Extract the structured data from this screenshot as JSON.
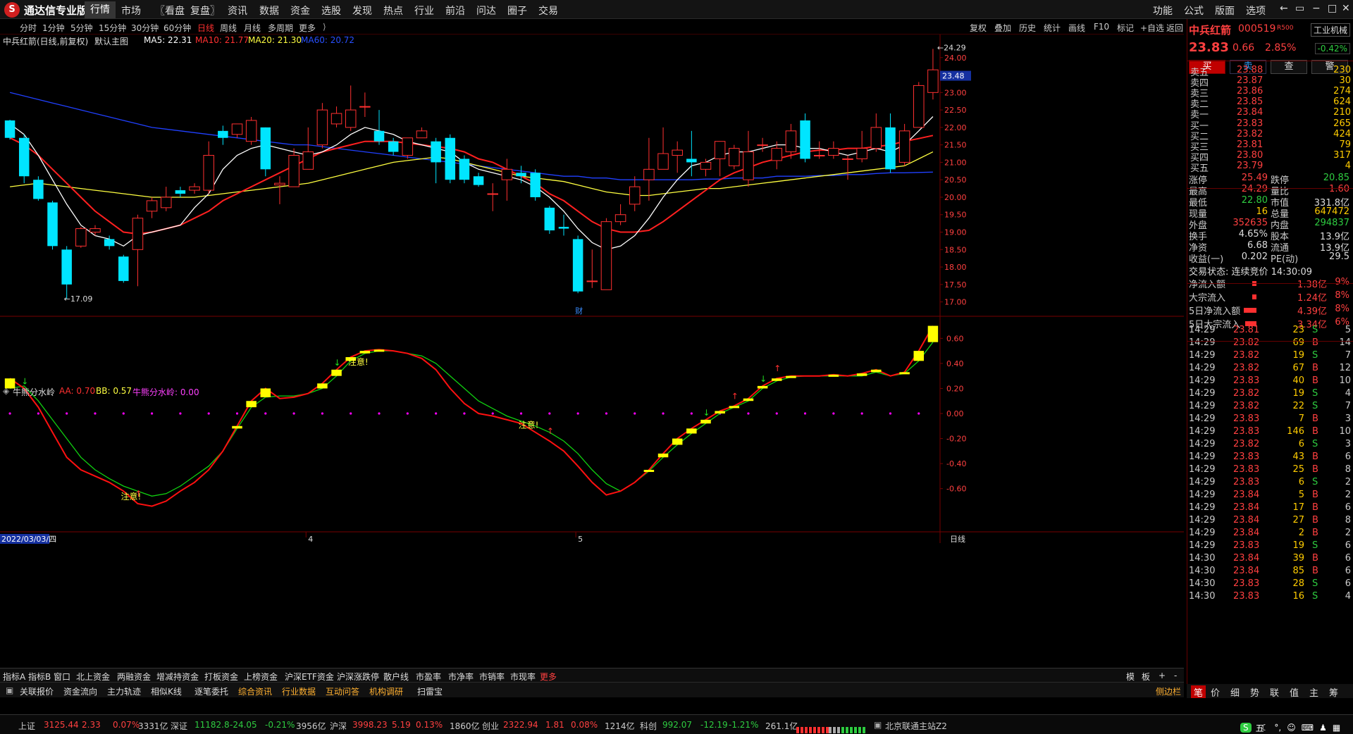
{
  "app": {
    "logo": "S",
    "title": "通达信专业版"
  },
  "menu": [
    "行情",
    "市场",
    "〖看盘",
    "复盘〗",
    "资讯",
    "数据",
    "资金",
    "选股",
    "发现",
    "热点",
    "行业",
    "前沿",
    "问达",
    "圈子",
    "交易"
  ],
  "menu_right": [
    "功能",
    "公式",
    "版面",
    "选项"
  ],
  "window_controls": [
    "←",
    "▭",
    "−",
    "□",
    "✕"
  ],
  "timeframes": [
    "分时",
    "1分钟",
    "5分钟",
    "15分钟",
    "30分钟",
    "60分钟",
    "日线",
    "周线",
    "月线",
    "多周期",
    "更多"
  ],
  "toolbar_right": [
    "复权",
    "叠加",
    "历史",
    "统计",
    "画线",
    "F10",
    "标记",
    "+自选",
    "返回"
  ],
  "colors": {
    "up": "#ff3030",
    "down": "#00e5ff",
    "ma5": "#ffffff",
    "ma10": "#ff2020",
    "ma20": "#ffff40",
    "ma60": "#2040ff",
    "fast": "#ff1010",
    "slow": "#10d010",
    "bar": "#ffff00",
    "zero": "#ff00ff"
  },
  "main_info": {
    "stock": "中兵红箭(日线,前复权)",
    "panel": "默认主图",
    "ma5": "MA5: 22.31",
    "ma10": "MA10: 21.77",
    "ma20": "MA20: 21.30",
    "ma60": "MA60: 20.72"
  },
  "sub_info": {
    "name": "牛熊分水岭",
    "aa": "AA: 0.70",
    "bb": "BB: 0.57",
    "line": "牛熊分水岭: 0.00"
  },
  "chart_data": {
    "type": "candlestick",
    "price_axis": {
      "ticks": [
        24.0,
        23.5,
        23.0,
        22.5,
        22.0,
        21.5,
        21.0,
        20.5,
        20.0,
        19.5,
        19.0,
        18.5,
        18.0,
        17.5,
        17.0
      ],
      "min": 16.75,
      "max": 24.5,
      "current_tag": "23.48"
    },
    "ind_axis": {
      "ticks": [
        0.6,
        0.4,
        0.2,
        0.0,
        -0.2,
        -0.4,
        -0.6
      ],
      "min": -0.9,
      "max": 0.72
    },
    "candles": [
      [
        22.2,
        21.7,
        22.22,
        21.65
      ],
      [
        21.7,
        20.6,
        21.8,
        20.4
      ],
      [
        20.5,
        19.95,
        20.6,
        19.9
      ],
      [
        19.85,
        18.6,
        19.9,
        18.5
      ],
      [
        18.5,
        17.5,
        18.6,
        17.09
      ],
      [
        18.6,
        19.1,
        19.15,
        18.55
      ],
      [
        19.0,
        19.1,
        19.2,
        18.9
      ],
      [
        18.8,
        18.6,
        18.9,
        18.5
      ],
      [
        18.3,
        17.6,
        18.35,
        17.55
      ],
      [
        18.5,
        19.4,
        19.5,
        17.45
      ],
      [
        19.6,
        19.9,
        20.0,
        19.4
      ],
      [
        19.7,
        20.0,
        20.3,
        19.6
      ],
      [
        20.2,
        20.1,
        20.3,
        20.0
      ],
      [
        20.2,
        20.3,
        20.4,
        20.1
      ],
      [
        20.2,
        21.2,
        21.6,
        20.1
      ],
      [
        21.9,
        21.7,
        22.05,
        21.5
      ],
      [
        21.8,
        22.1,
        22.1,
        21.7
      ],
      [
        21.6,
        22.2,
        22.3,
        21.5
      ],
      [
        22.0,
        20.8,
        22.0,
        20.6
      ],
      [
        20.35,
        20.4,
        20.6,
        19.8
      ],
      [
        20.3,
        21.2,
        21.4,
        20.3
      ],
      [
        20.8,
        21.3,
        22.0,
        20.8
      ],
      [
        21.5,
        22.5,
        22.7,
        21.4
      ],
      [
        22.1,
        22.4,
        22.6,
        22.0
      ],
      [
        22.0,
        22.5,
        23.2,
        21.9
      ],
      [
        22.6,
        22.6,
        23.0,
        22.3
      ],
      [
        21.9,
        21.6,
        22.5,
        21.5
      ],
      [
        21.6,
        21.3,
        21.7,
        21.2
      ],
      [
        21.2,
        21.7,
        21.7,
        21.1
      ],
      [
        21.7,
        21.9,
        22.0,
        21.7
      ],
      [
        21.6,
        21.0,
        21.7,
        20.4
      ],
      [
        21.7,
        20.5,
        21.8,
        20.4
      ],
      [
        21.1,
        20.5,
        21.2,
        20.4
      ],
      [
        20.6,
        20.35,
        20.7,
        20.3
      ],
      [
        20.1,
        20.1,
        20.4,
        19.6
      ],
      [
        20.5,
        20.8,
        21.1,
        19.9
      ],
      [
        20.7,
        20.6,
        20.9,
        20.4
      ],
      [
        20.7,
        20.0,
        20.8,
        19.9
      ],
      [
        19.7,
        19.05,
        19.75,
        18.95
      ],
      [
        19.15,
        19.1,
        19.5,
        18.9
      ],
      [
        18.8,
        17.3,
        18.9,
        17.25
      ],
      [
        17.6,
        17.6,
        18.5,
        17.4
      ],
      [
        17.35,
        19.3,
        19.4,
        17.35
      ],
      [
        19.3,
        19.5,
        19.8,
        19.2
      ],
      [
        19.8,
        20.3,
        20.6,
        19.6
      ],
      [
        20.5,
        20.8,
        21.7,
        19.9
      ],
      [
        20.8,
        21.25,
        22.0,
        20.8
      ],
      [
        21.2,
        21.35,
        21.6,
        20.7
      ],
      [
        21.1,
        21.0,
        21.9,
        20.6
      ],
      [
        20.8,
        21.0,
        21.1,
        20.6
      ],
      [
        21.1,
        21.6,
        21.6,
        20.6
      ],
      [
        20.9,
        21.4,
        21.5,
        20.8
      ],
      [
        20.5,
        21.3,
        21.9,
        20.3
      ],
      [
        21.5,
        21.5,
        21.7,
        21.3
      ],
      [
        21.05,
        21.4,
        21.6,
        20.8
      ],
      [
        21.3,
        21.9,
        22.1,
        21.1
      ],
      [
        22.2,
        21.1,
        22.4,
        21.0
      ],
      [
        21.2,
        21.2,
        21.6,
        21.1
      ],
      [
        21.2,
        21.4,
        21.6,
        21.1
      ],
      [
        21.1,
        21.1,
        21.2,
        20.5
      ],
      [
        21.1,
        21.4,
        21.9,
        21.0
      ],
      [
        21.4,
        22.0,
        22.4,
        21.3
      ],
      [
        22.0,
        20.8,
        22.4,
        20.7
      ],
      [
        21.0,
        21.9,
        22.1,
        20.9
      ],
      [
        22.0,
        23.2,
        23.3,
        22.0
      ],
      [
        23.0,
        23.65,
        24.25,
        22.8
      ]
    ],
    "ma5": [
      22.1,
      21.8,
      21.2,
      20.5,
      19.8,
      19.2,
      18.9,
      18.8,
      18.6,
      18.9,
      19.0,
      19.1,
      19.2,
      19.7,
      20.1,
      20.8,
      21.2,
      21.4,
      21.5,
      21.4,
      21.3,
      21.2,
      21.3,
      21.5,
      21.8,
      22.0,
      21.9,
      21.8,
      21.6,
      21.5,
      21.4,
      21.3,
      21.0,
      20.8,
      20.7,
      20.6,
      20.5,
      20.3,
      20.0,
      19.6,
      19.1,
      18.7,
      18.5,
      18.6,
      18.9,
      19.4,
      20.0,
      20.5,
      20.9,
      21.0,
      21.2,
      21.3,
      21.3,
      21.4,
      21.5,
      21.5,
      21.4,
      21.4,
      21.3,
      21.2,
      21.3,
      21.4,
      21.3,
      21.5,
      21.9,
      22.31
    ],
    "ma10": [
      21.7,
      21.5,
      21.2,
      20.8,
      20.4,
      20.0,
      19.6,
      19.3,
      19.0,
      18.95,
      19.0,
      19.1,
      19.2,
      19.4,
      19.6,
      19.9,
      20.1,
      20.3,
      20.5,
      20.7,
      20.9,
      21.1,
      21.3,
      21.4,
      21.5,
      21.6,
      21.6,
      21.6,
      21.55,
      21.5,
      21.45,
      21.4,
      21.3,
      21.1,
      21.0,
      20.8,
      20.6,
      20.4,
      20.1,
      19.9,
      19.6,
      19.3,
      19.1,
      19.0,
      19.0,
      19.05,
      19.3,
      19.6,
      19.9,
      20.2,
      20.5,
      20.7,
      20.85,
      21.0,
      21.1,
      21.2,
      21.3,
      21.35,
      21.35,
      21.4,
      21.4,
      21.45,
      21.5,
      21.6,
      21.68,
      21.77
    ],
    "ma20": [
      20.3,
      20.35,
      20.4,
      20.35,
      20.3,
      20.25,
      20.2,
      20.15,
      20.1,
      20.05,
      20.0,
      20.0,
      20.0,
      20.0,
      20.05,
      20.1,
      20.15,
      20.2,
      20.25,
      20.3,
      20.35,
      20.4,
      20.5,
      20.6,
      20.7,
      20.8,
      20.9,
      21.0,
      21.05,
      21.1,
      21.15,
      21.1,
      21.0,
      20.9,
      20.8,
      20.7,
      20.6,
      20.55,
      20.5,
      20.45,
      20.35,
      20.25,
      20.15,
      20.1,
      20.05,
      20.05,
      20.1,
      20.15,
      20.2,
      20.25,
      20.25,
      20.3,
      20.35,
      20.4,
      20.45,
      20.5,
      20.55,
      20.6,
      20.65,
      20.7,
      20.75,
      20.8,
      20.85,
      20.9,
      21.1,
      21.3
    ],
    "ma60": [
      23.0,
      22.9,
      22.8,
      22.7,
      22.6,
      22.5,
      22.4,
      22.3,
      22.2,
      22.1,
      22.0,
      21.95,
      21.9,
      21.85,
      21.8,
      21.75,
      21.7,
      21.65,
      21.6,
      21.55,
      21.5,
      21.5,
      21.45,
      21.4,
      21.35,
      21.3,
      21.25,
      21.2,
      21.15,
      21.1,
      21.05,
      21.0,
      20.95,
      20.9,
      20.85,
      20.8,
      20.75,
      20.7,
      20.65,
      20.6,
      20.6,
      20.55,
      20.55,
      20.5,
      20.5,
      20.5,
      20.5,
      20.5,
      20.5,
      20.52,
      20.52,
      20.55,
      20.55,
      20.55,
      20.6,
      20.6,
      20.6,
      20.62,
      20.62,
      20.65,
      20.65,
      20.68,
      20.7,
      20.7,
      20.71,
      20.72
    ],
    "aa": [
      0.28,
      0.2,
      0.05,
      -0.15,
      -0.35,
      -0.45,
      -0.5,
      -0.55,
      -0.62,
      -0.72,
      -0.74,
      -0.7,
      -0.62,
      -0.55,
      -0.45,
      -0.3,
      -0.1,
      0.1,
      0.2,
      0.12,
      0.13,
      0.16,
      0.24,
      0.35,
      0.45,
      0.5,
      0.51,
      0.5,
      0.48,
      0.44,
      0.35,
      0.2,
      0.08,
      0.0,
      -0.02,
      -0.05,
      -0.08,
      -0.15,
      -0.22,
      -0.3,
      -0.42,
      -0.55,
      -0.65,
      -0.62,
      -0.55,
      -0.45,
      -0.32,
      -0.2,
      -0.12,
      -0.05,
      0.02,
      0.06,
      0.12,
      0.22,
      0.28,
      0.3,
      0.3,
      0.3,
      0.31,
      0.3,
      0.32,
      0.35,
      0.3,
      0.33,
      0.5,
      0.7
    ],
    "bb": [
      0.2,
      0.22,
      0.1,
      -0.05,
      -0.2,
      -0.35,
      -0.45,
      -0.52,
      -0.58,
      -0.62,
      -0.66,
      -0.64,
      -0.58,
      -0.5,
      -0.42,
      -0.3,
      -0.12,
      0.05,
      0.13,
      0.14,
      0.14,
      0.16,
      0.2,
      0.3,
      0.42,
      0.48,
      0.5,
      0.5,
      0.48,
      0.46,
      0.4,
      0.3,
      0.2,
      0.1,
      0.04,
      -0.02,
      -0.06,
      -0.1,
      -0.15,
      -0.22,
      -0.32,
      -0.45,
      -0.56,
      -0.62,
      -0.55,
      -0.46,
      -0.35,
      -0.25,
      -0.16,
      -0.08,
      0.0,
      0.05,
      0.1,
      0.2,
      0.26,
      0.29,
      0.3,
      0.3,
      0.3,
      0.3,
      0.3,
      0.33,
      0.3,
      0.32,
      0.42,
      0.57
    ],
    "annotations": [
      {
        "text": "注意!",
        "index": 9
      },
      {
        "text": "注意!",
        "index": 25
      },
      {
        "text": "注意!",
        "index": 37
      }
    ],
    "up_arrows": [
      9,
      38,
      51,
      54
    ],
    "down_arrows": [
      1,
      23,
      49,
      53
    ],
    "hi_label": "24.29",
    "lo_label": "17.09",
    "cai_label": "财",
    "x_labels": [
      {
        "text": "2022/03/03/四",
        "index": 0
      },
      {
        "text": "4",
        "index": 21
      },
      {
        "text": "5",
        "index": 40
      }
    ],
    "x_right_label": "日线"
  },
  "quote": {
    "name": "中兵红箭",
    "code": "000519",
    "rzrq": "R500",
    "industry": "工业机械",
    "price": "23.83",
    "change": "0.66",
    "pct": "2.85%",
    "ind_chg": "-0.42%"
  },
  "trade_buttons": [
    "买",
    "卖",
    "查",
    "警"
  ],
  "asks": [
    {
      "label": "卖五",
      "price": "23.88",
      "vol": "230"
    },
    {
      "label": "卖四",
      "price": "23.87",
      "vol": "30"
    },
    {
      "label": "卖三",
      "price": "23.86",
      "vol": "274"
    },
    {
      "label": "卖二",
      "price": "23.85",
      "vol": "624"
    },
    {
      "label": "卖一",
      "price": "23.84",
      "vol": "210"
    }
  ],
  "bids": [
    {
      "label": "买一",
      "price": "23.83",
      "vol": "265"
    },
    {
      "label": "买二",
      "price": "23.82",
      "vol": "424"
    },
    {
      "label": "买三",
      "price": "23.81",
      "vol": "79"
    },
    {
      "label": "买四",
      "price": "23.80",
      "vol": "317"
    },
    {
      "label": "买五",
      "price": "23.79",
      "vol": "4"
    }
  ],
  "stats": [
    [
      {
        "l": "涨停",
        "v": "25.49",
        "c": "#ff4040"
      },
      {
        "l": "跌停",
        "v": "20.85",
        "c": "#2ecc40"
      }
    ],
    [
      {
        "l": "最高",
        "v": "24.29",
        "c": "#ff4040"
      },
      {
        "l": "量比",
        "v": "1.60",
        "c": "#ff4040"
      }
    ],
    [
      {
        "l": "最低",
        "v": "22.80",
        "c": "#2ecc40"
      },
      {
        "l": "市值",
        "v": "331.8亿",
        "c": "#ddd"
      }
    ],
    [
      {
        "l": "现量",
        "v": "16",
        "c": "#ffcc00"
      },
      {
        "l": "总量",
        "v": "647472",
        "c": "#ffcc00"
      }
    ],
    [
      {
        "l": "外盘",
        "v": "352635",
        "c": "#ff4040"
      },
      {
        "l": "内盘",
        "v": "294837",
        "c": "#2ecc40"
      }
    ],
    [
      {
        "l": "换手",
        "v": "4.65%",
        "c": "#ddd"
      },
      {
        "l": "股本",
        "v": "13.9亿",
        "c": "#ddd"
      }
    ],
    [
      {
        "l": "净资",
        "v": "6.68",
        "c": "#ddd"
      },
      {
        "l": "流通",
        "v": "13.9亿",
        "c": "#ddd"
      }
    ],
    [
      {
        "l": "收益(一)",
        "v": "0.202",
        "c": "#ddd"
      },
      {
        "l": "PE(动)",
        "v": "29.5",
        "c": "#ddd"
      }
    ]
  ],
  "trade_status": "交易状态: 连续竞价 14:30:09",
  "flows": [
    {
      "l": "净流入额",
      "v": "1.38亿",
      "p": "9%",
      "w": 6
    },
    {
      "l": "大宗流入",
      "v": "1.24亿",
      "p": "8%",
      "w": 6
    },
    {
      "l": "5日净流入额",
      "v": "4.39亿",
      "p": "8%",
      "w": 18
    },
    {
      "l": "5日大宗流入",
      "v": "3.34亿",
      "p": "6%",
      "w": 16
    }
  ],
  "ticks": [
    [
      "14:29",
      "23.81",
      "23",
      "S",
      "5"
    ],
    [
      "14:29",
      "23.82",
      "69",
      "B",
      "14"
    ],
    [
      "14:29",
      "23.82",
      "19",
      "S",
      "7"
    ],
    [
      "14:29",
      "23.82",
      "67",
      "B",
      "12"
    ],
    [
      "14:29",
      "23.83",
      "40",
      "B",
      "10"
    ],
    [
      "14:29",
      "23.82",
      "19",
      "S",
      "4"
    ],
    [
      "14:29",
      "23.82",
      "22",
      "S",
      "7"
    ],
    [
      "14:29",
      "23.83",
      "7",
      "B",
      "3"
    ],
    [
      "14:29",
      "23.83",
      "146",
      "B",
      "10"
    ],
    [
      "14:29",
      "23.82",
      "6",
      "S",
      "3"
    ],
    [
      "14:29",
      "23.83",
      "43",
      "B",
      "6"
    ],
    [
      "14:29",
      "23.83",
      "25",
      "B",
      "8"
    ],
    [
      "14:29",
      "23.83",
      "6",
      "S",
      "2"
    ],
    [
      "14:29",
      "23.84",
      "5",
      "B",
      "2"
    ],
    [
      "14:29",
      "23.84",
      "17",
      "B",
      "6"
    ],
    [
      "14:29",
      "23.84",
      "27",
      "B",
      "8"
    ],
    [
      "14:29",
      "23.84",
      "2",
      "B",
      "2"
    ],
    [
      "14:29",
      "23.83",
      "19",
      "S",
      "6"
    ],
    [
      "14:30",
      "23.84",
      "39",
      "B",
      "6"
    ],
    [
      "14:30",
      "23.84",
      "85",
      "B",
      "6"
    ],
    [
      "14:30",
      "23.83",
      "28",
      "S",
      "6"
    ],
    [
      "14:30",
      "23.83",
      "16",
      "S",
      "4"
    ]
  ],
  "bottom_tabs1": [
    "指标A",
    "指标B",
    "窗口",
    "北上资金",
    "两融资金",
    "增减持资金",
    "打板资金",
    "上榜资金",
    "沪深ETF资金",
    "沪深涨跌停",
    "散户线",
    "市盈率",
    "市净率",
    "市销率",
    "市现率",
    "更多"
  ],
  "bottom_tabs1_right": [
    "模",
    "板",
    "+",
    "-"
  ],
  "bottom_tabs2": [
    "关联报价",
    "资金流向",
    "主力轨迹",
    "相似K线",
    "逐笔委托",
    "综合资讯",
    "行业数据",
    "互动问答",
    "机构调研",
    "扫雷宝"
  ],
  "bottom_tabs2_right": "侧边栏",
  "rp_tabs": [
    "笔",
    "价",
    "细",
    "势",
    "联",
    "值",
    "主",
    "筹"
  ],
  "status": [
    {
      "t": "上证",
      "c": "#ccc"
    },
    {
      "t": "3125.44",
      "c": "#ff4040"
    },
    {
      "t": "2.33",
      "c": "#ff4040"
    },
    {
      "t": "0.07%",
      "c": "#ff4040"
    },
    {
      "t": "3331亿",
      "c": "#ccc"
    },
    {
      "t": "深证",
      "c": "#ccc"
    },
    {
      "t": "11182.8",
      "c": "#2ecc40"
    },
    {
      "t": "-24.05",
      "c": "#2ecc40"
    },
    {
      "t": "-0.21%",
      "c": "#2ecc40"
    },
    {
      "t": "3956亿",
      "c": "#ccc"
    },
    {
      "t": "沪深",
      "c": "#ccc"
    },
    {
      "t": "3998.23",
      "c": "#ff4040"
    },
    {
      "t": "5.19",
      "c": "#ff4040"
    },
    {
      "t": "0.13%",
      "c": "#ff4040"
    },
    {
      "t": "1860亿",
      "c": "#ccc"
    },
    {
      "t": "创业",
      "c": "#ccc"
    },
    {
      "t": "2322.94",
      "c": "#ff4040"
    },
    {
      "t": "1.81",
      "c": "#ff4040"
    },
    {
      "t": "0.08%",
      "c": "#ff4040"
    },
    {
      "t": "1214亿",
      "c": "#ccc"
    },
    {
      "t": "科创",
      "c": "#ccc"
    },
    {
      "t": "992.07",
      "c": "#2ecc40"
    },
    {
      "t": "-12.19",
      "c": "#2ecc40"
    },
    {
      "t": "-1.21%",
      "c": "#2ecc40"
    },
    {
      "t": "261.1亿",
      "c": "#ccc"
    }
  ],
  "server": "北京联通主站Z2",
  "ime": "五"
}
